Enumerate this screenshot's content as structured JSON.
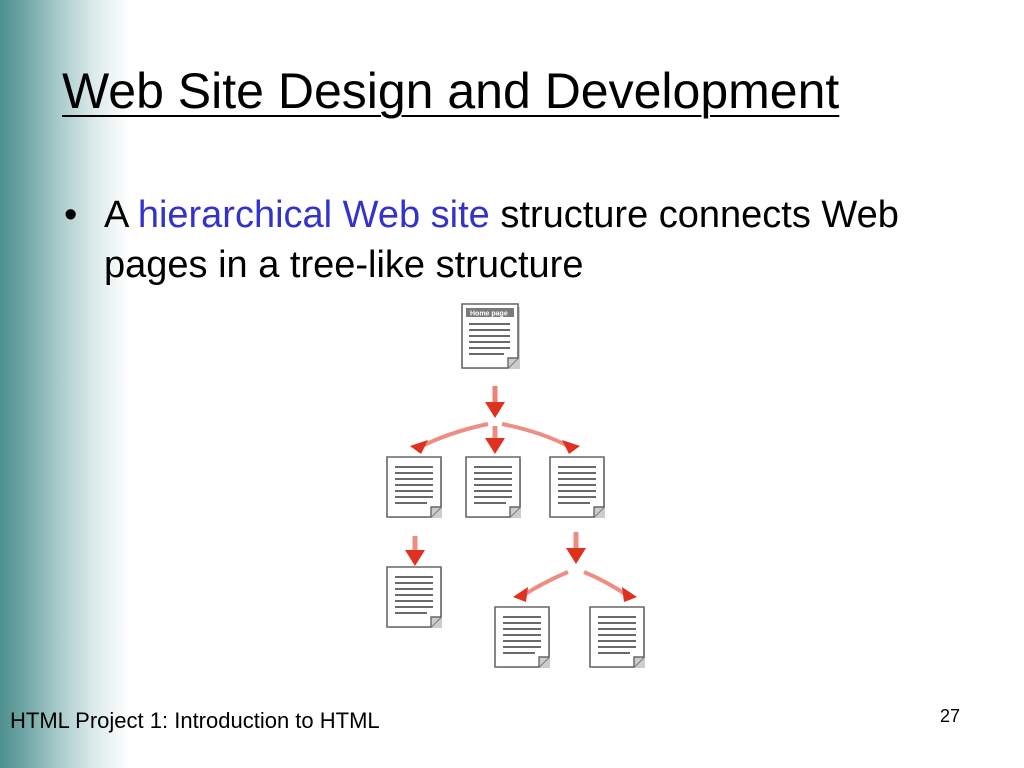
{
  "slide": {
    "title": "Web Site Design and Development",
    "bullet": {
      "marker": "•",
      "before": "A ",
      "highlight": "hierarchical Web site",
      "after": " structure connects Web pages in a tree-like structure"
    },
    "diagram": {
      "root_label": "Home page",
      "page_icon": "document-page-icon",
      "arrow_icon": "red-arrow-icon"
    },
    "footer": "HTML Project 1: Introduction to HTML",
    "page_number": "27"
  },
  "colors": {
    "highlight": "#3333cc",
    "arrow": "#e0301e",
    "sidebar": "#4e8f8f"
  }
}
